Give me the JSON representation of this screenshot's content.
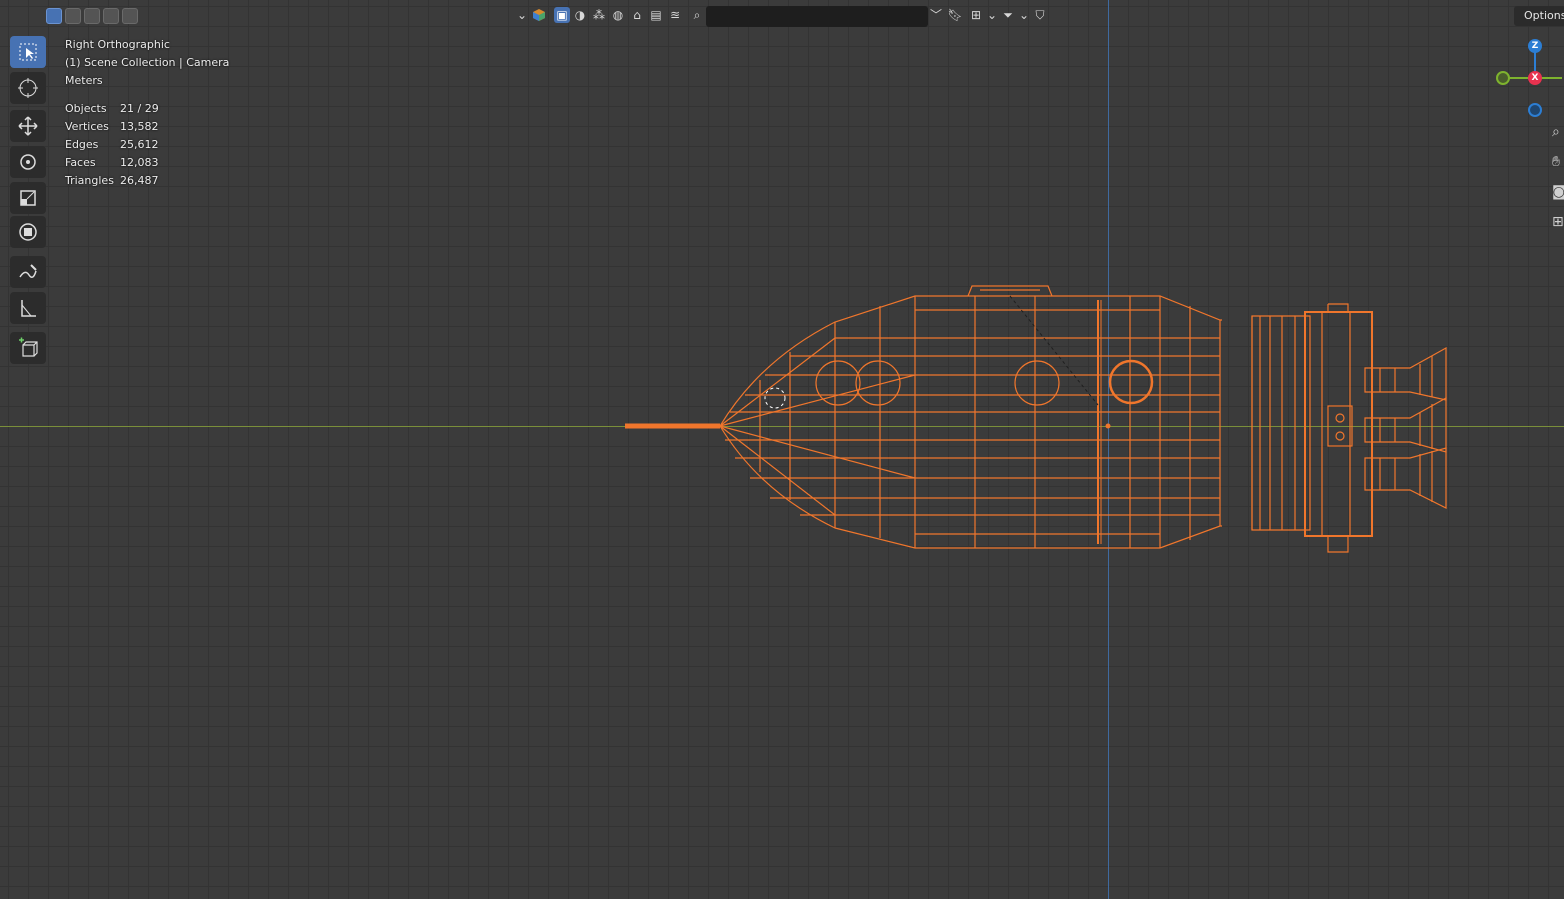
{
  "header": {
    "search": {
      "placeholder": ""
    },
    "options_label": "Options"
  },
  "overlay": {
    "view_name": "Right Orthographic",
    "collection_info": "(1) Scene Collection | Camera",
    "units": "Meters"
  },
  "stats": [
    {
      "label": "Objects",
      "value": "21 / 29"
    },
    {
      "label": "Vertices",
      "value": "13,582"
    },
    {
      "label": "Edges",
      "value": "25,612"
    },
    {
      "label": "Faces",
      "value": "12,083"
    },
    {
      "label": "Triangles",
      "value": "26,487"
    }
  ],
  "gizmo": {
    "z_label": "Z",
    "x_label": "X"
  },
  "colors": {
    "viewport_bg": "#3b3b3b",
    "grid_line": "#333333",
    "selection_wire": "#f0762c",
    "active_tool": "#4772b3",
    "axis_x_line": "#7a8f3a",
    "axis_z_line": "#3f6aa0",
    "gizmo_x": "#e8324f",
    "gizmo_y": "#7eb32e",
    "gizmo_z": "#2c7ed4"
  },
  "icons": {
    "toolbar": [
      "select-box-icon",
      "cursor-icon",
      "move-icon",
      "rotate-icon",
      "scale-icon",
      "transform-icon",
      "annotate-icon",
      "measure-icon",
      "add-cube-icon"
    ],
    "right_edge": [
      "zoom-icon",
      "hand-pan-icon",
      "camera-icon",
      "grid-icon"
    ]
  }
}
